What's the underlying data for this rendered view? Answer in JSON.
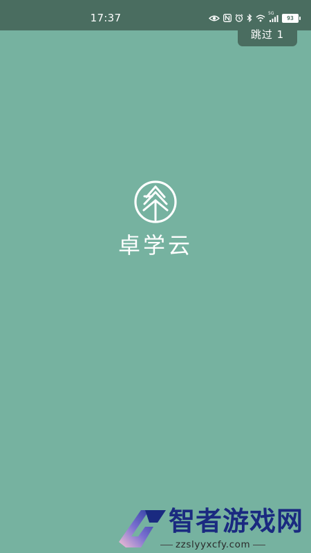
{
  "status_bar": {
    "time": "17:37",
    "icons": [
      "eye-icon",
      "nfc-icon",
      "alarm-icon",
      "bluetooth-icon",
      "wifi-icon",
      "signal-icon"
    ],
    "network_label": "5G",
    "battery_level": "93"
  },
  "splash": {
    "skip_label": "跳过 1",
    "app_name": "卓学云",
    "background_color": "#76b2a0"
  },
  "watermark": {
    "title": "智者游戏网",
    "url": "zzslyyxcfy.com"
  }
}
